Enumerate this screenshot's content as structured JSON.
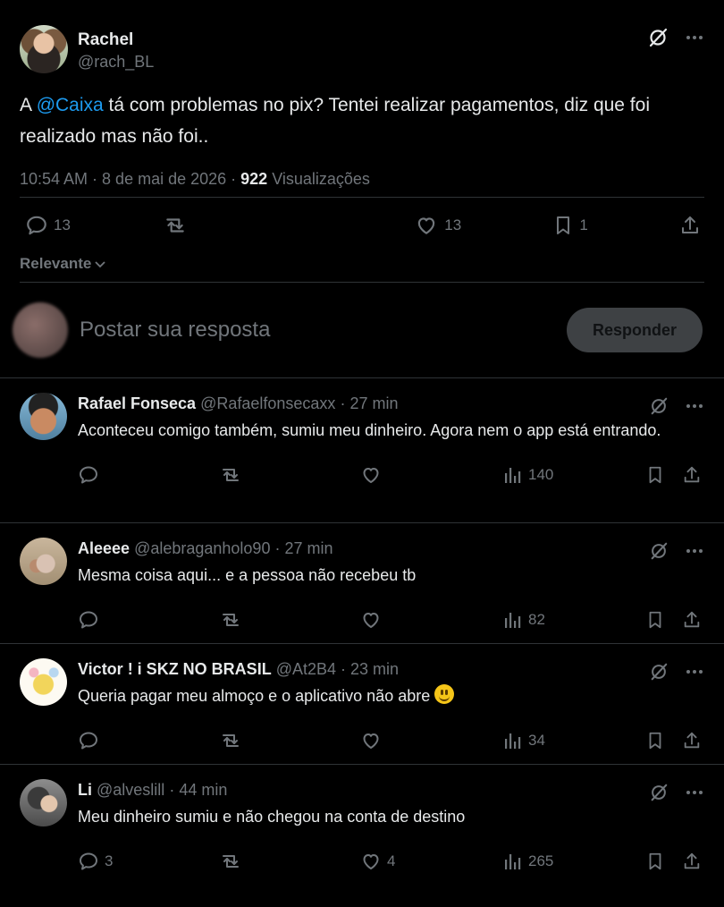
{
  "post": {
    "author_name": "Rachel",
    "author_handle": "@rach_BL",
    "text_before": "A ",
    "mention": "@Caixa",
    "text_after": " tá com problemas no pix? Tentei realizar pagamentos, diz que foi realizado mas não foi..",
    "timestamp": "10:54 AM · 8 de mai de 2026",
    "meta_sep": " · ",
    "views_count": "922",
    "views_label": " Visualizações",
    "replies": "13",
    "likes": "13",
    "bookmarks": "1"
  },
  "sort": {
    "label": "Relevante"
  },
  "composer": {
    "placeholder": "Postar sua resposta",
    "button": "Responder"
  },
  "replies": [
    {
      "name": "Rafael Fonseca",
      "handle": "@Rafaelfonsecaxx",
      "time": "27 min",
      "text": "Aconteceu comigo também, sumiu meu dinheiro. Agora nem o app está entrando.",
      "replies": "",
      "likes": "",
      "views": "140"
    },
    {
      "name": "Aleeee",
      "handle": "@alebraganholo90",
      "time": "27 min",
      "text": "Mesma coisa aqui... e a pessoa não recebeu tb",
      "replies": "",
      "likes": "",
      "views": "82"
    },
    {
      "name": "Victor ! i SKZ NO BRASIL",
      "handle": "@At2B4",
      "time": "23 min",
      "text": "Queria pagar meu almoço e o aplicativo não abre",
      "replies": "",
      "likes": "",
      "views": "34"
    },
    {
      "name": "Li",
      "handle": "@alveslill",
      "time": "44 min",
      "text": "Meu dinheiro sumiu e não chegou na conta de destino",
      "replies": "3",
      "likes": "4",
      "views": "265"
    }
  ],
  "sep": " · ",
  "icons": {
    "grok": "grok-icon",
    "more": "more-icon",
    "reply": "reply-icon",
    "repost": "repost-icon",
    "like": "like-icon",
    "bookmark": "bookmark-icon",
    "share": "share-icon",
    "views": "views-icon"
  },
  "colors": {
    "background": "#000000",
    "text": "#e7e9ea",
    "muted": "#71767b",
    "link": "#1d9bf0",
    "divider": "#2f3336"
  }
}
